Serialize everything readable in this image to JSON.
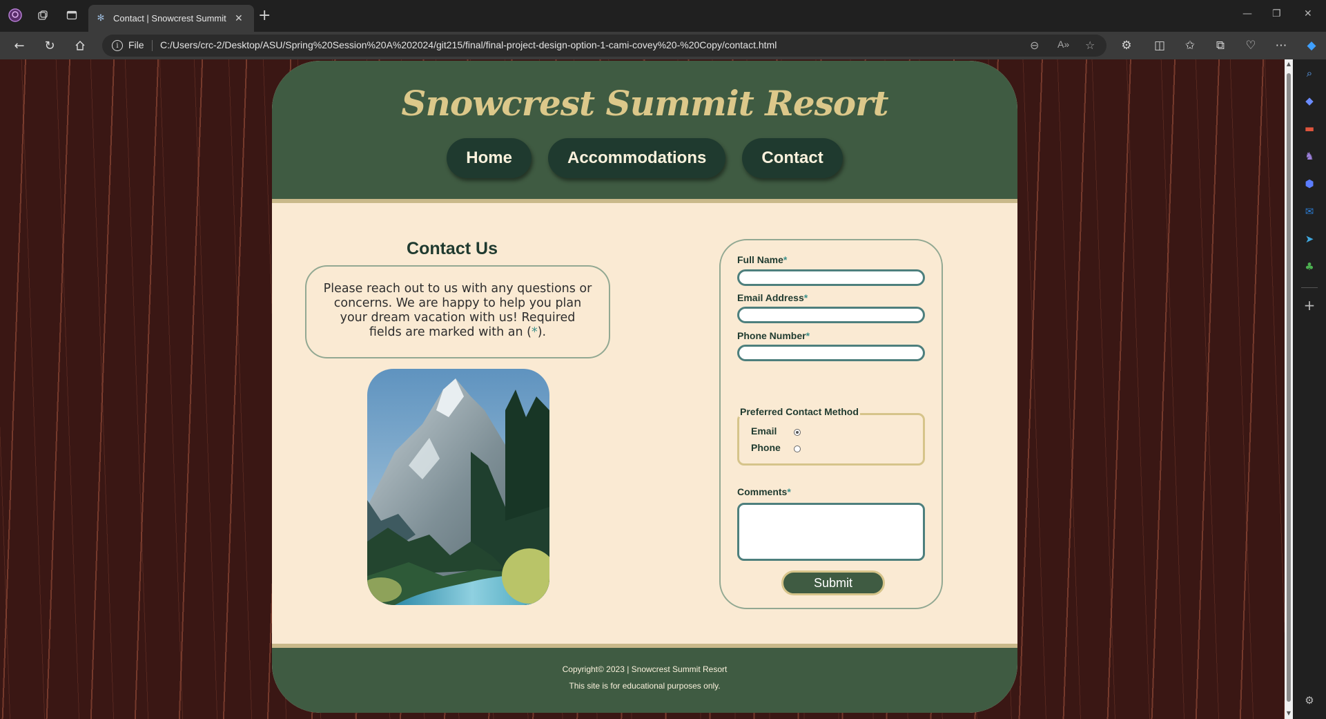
{
  "browser": {
    "tab_title": "Contact | Snowcrest Summit Resort",
    "url_scheme_label": "File",
    "url": "C:/Users/crc-2/Desktop/ASU/Spring%20Session%20A%202024/git215/final/final-project-design-option-1-cami-covey%20-%20Copy/contact.html"
  },
  "site": {
    "title": "Snowcrest Summit Resort",
    "nav": [
      {
        "label": "Home"
      },
      {
        "label": "Accommodations"
      },
      {
        "label": "Contact"
      }
    ]
  },
  "contact": {
    "heading": "Contact Us",
    "intro_text": "Please reach out to us with any questions or concerns. We are happy to help you plan your dream vacation with us! Required fields are marked with an (",
    "intro_asterisk": "*",
    "intro_close": ")."
  },
  "form": {
    "full_name_label": "Full Name",
    "email_label": "Email Address",
    "phone_label": "Phone Number",
    "required_marker": "*",
    "contact_method_legend": "Preferred Contact Method",
    "method_email": "Email",
    "method_phone": "Phone",
    "selected_method": "Email",
    "comments_label": "Comments",
    "submit_label": "Submit"
  },
  "footer": {
    "copyright": "Copyright© 2023 | Snowcrest Summit Resort",
    "disclaimer": "This site is for educational purposes only."
  },
  "colors": {
    "header_green": "#3f5b42",
    "nav_button": "#1f3a2f",
    "title_gold": "#dcc88a",
    "content_cream": "#faead3",
    "page_background": "#3a1714",
    "input_border": "#4d7f7d"
  }
}
